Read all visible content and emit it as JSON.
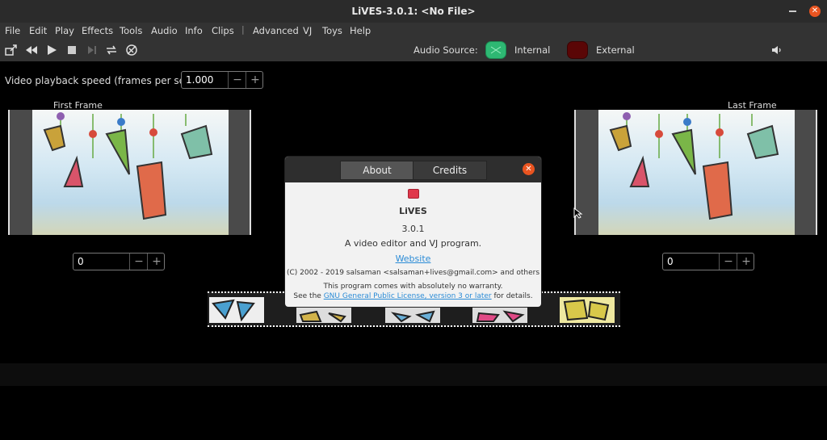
{
  "window": {
    "title": "LiVES-3.0.1: <No File>"
  },
  "menu": [
    "File",
    "Edit",
    "Play",
    "Effects",
    "Tools",
    "Audio",
    "Info",
    "Clips",
    "Advanced",
    "VJ",
    "Toys",
    "Help"
  ],
  "menu_separator": "|",
  "toolbar": {
    "audio_source_label": "Audio Source:",
    "internal_label": "Internal",
    "external_label": "External",
    "internal_color": "#2eb873",
    "external_color": "#5a0606"
  },
  "playback": {
    "speed_label": "Video playback speed (frames per second)",
    "speed_value": "1.000"
  },
  "frames": {
    "first_label": "First Frame",
    "last_label": "Last Frame",
    "first_value": "0",
    "last_value": "0"
  },
  "spin": {
    "minus": "−",
    "plus": "+"
  },
  "about": {
    "tab_about": "About",
    "tab_credits": "Credits",
    "app_name": "LiVES",
    "version": "3.0.1",
    "description": "A video editor and VJ program.",
    "website": "Website",
    "copyright": "(C) 2002 - 2019 salsaman <salsaman+lives@gmail.com> and others",
    "warranty": "This program comes with absolutely no warranty.",
    "license_prefix": "See the",
    "license_link": "GNU General Public License, version 3 or later",
    "license_suffix": "for details."
  }
}
